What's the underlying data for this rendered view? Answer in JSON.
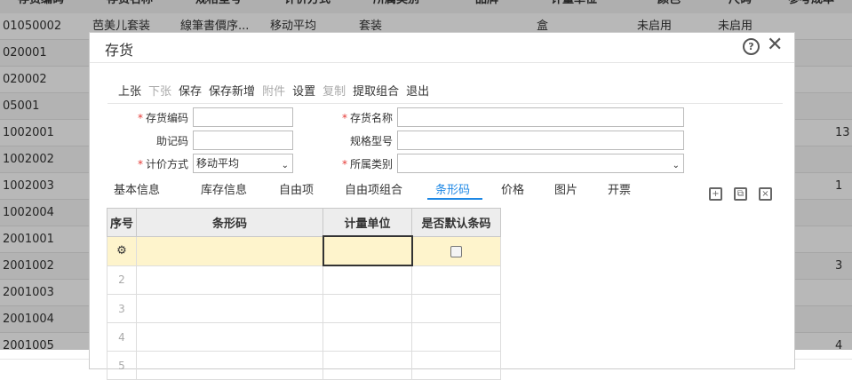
{
  "background_table": {
    "headers": [
      "存货编码",
      "存货名称",
      "规格型号",
      "计价方式",
      "所属类别",
      "品牌",
      "计量单位",
      "颜色",
      "尺码",
      "参考成本"
    ],
    "rows": [
      {
        "code": "01050002",
        "name": "芭美儿套装",
        "spec": "線筆書價序...",
        "method": "移动平均",
        "category": "套装",
        "unit": "盒",
        "color": "未启用",
        "size": "未启用",
        "cost": ""
      },
      {
        "code": "020001",
        "cost": ""
      },
      {
        "code": "020002",
        "cost": ""
      },
      {
        "code": "05001",
        "cost": ""
      },
      {
        "code": "1002001",
        "cost": "13"
      },
      {
        "code": "1002002",
        "cost": ""
      },
      {
        "code": "1002003",
        "cost": "1"
      },
      {
        "code": "1002004",
        "cost": ""
      },
      {
        "code": "2001001",
        "cost": ""
      },
      {
        "code": "2001002",
        "cost": "3"
      },
      {
        "code": "2001003",
        "cost": ""
      },
      {
        "code": "2001004",
        "cost": ""
      },
      {
        "code": "2001005",
        "cost": "4"
      }
    ]
  },
  "modal": {
    "title": "存货",
    "toolbar": [
      {
        "label": "上张",
        "enabled": true
      },
      {
        "label": "下张",
        "enabled": false
      },
      {
        "label": "保存",
        "enabled": true
      },
      {
        "label": "保存新增",
        "enabled": true
      },
      {
        "label": "附件",
        "enabled": false
      },
      {
        "label": "设置",
        "enabled": true
      },
      {
        "label": "复制",
        "enabled": false
      },
      {
        "label": "提取组合",
        "enabled": true
      },
      {
        "label": "退出",
        "enabled": true
      }
    ],
    "form": {
      "code_label": "存货编码",
      "code_value": "",
      "name_label": "存货名称",
      "name_value": "",
      "mnemonic_label": "助记码",
      "mnemonic_value": "",
      "spec_label": "规格型号",
      "spec_value": "",
      "method_label": "计价方式",
      "method_value": "移动平均",
      "category_label": "所属类别",
      "category_value": ""
    },
    "tabs": [
      "基本信息",
      "库存信息",
      "自由项",
      "自由项组合",
      "条形码",
      "价格",
      "图片",
      "开票"
    ],
    "active_tab": "条形码",
    "table": {
      "headers": [
        "序号",
        "条形码",
        "计量单位",
        "是否默认条码"
      ],
      "rows": [
        "",
        "2",
        "3",
        "4",
        "5"
      ]
    }
  }
}
